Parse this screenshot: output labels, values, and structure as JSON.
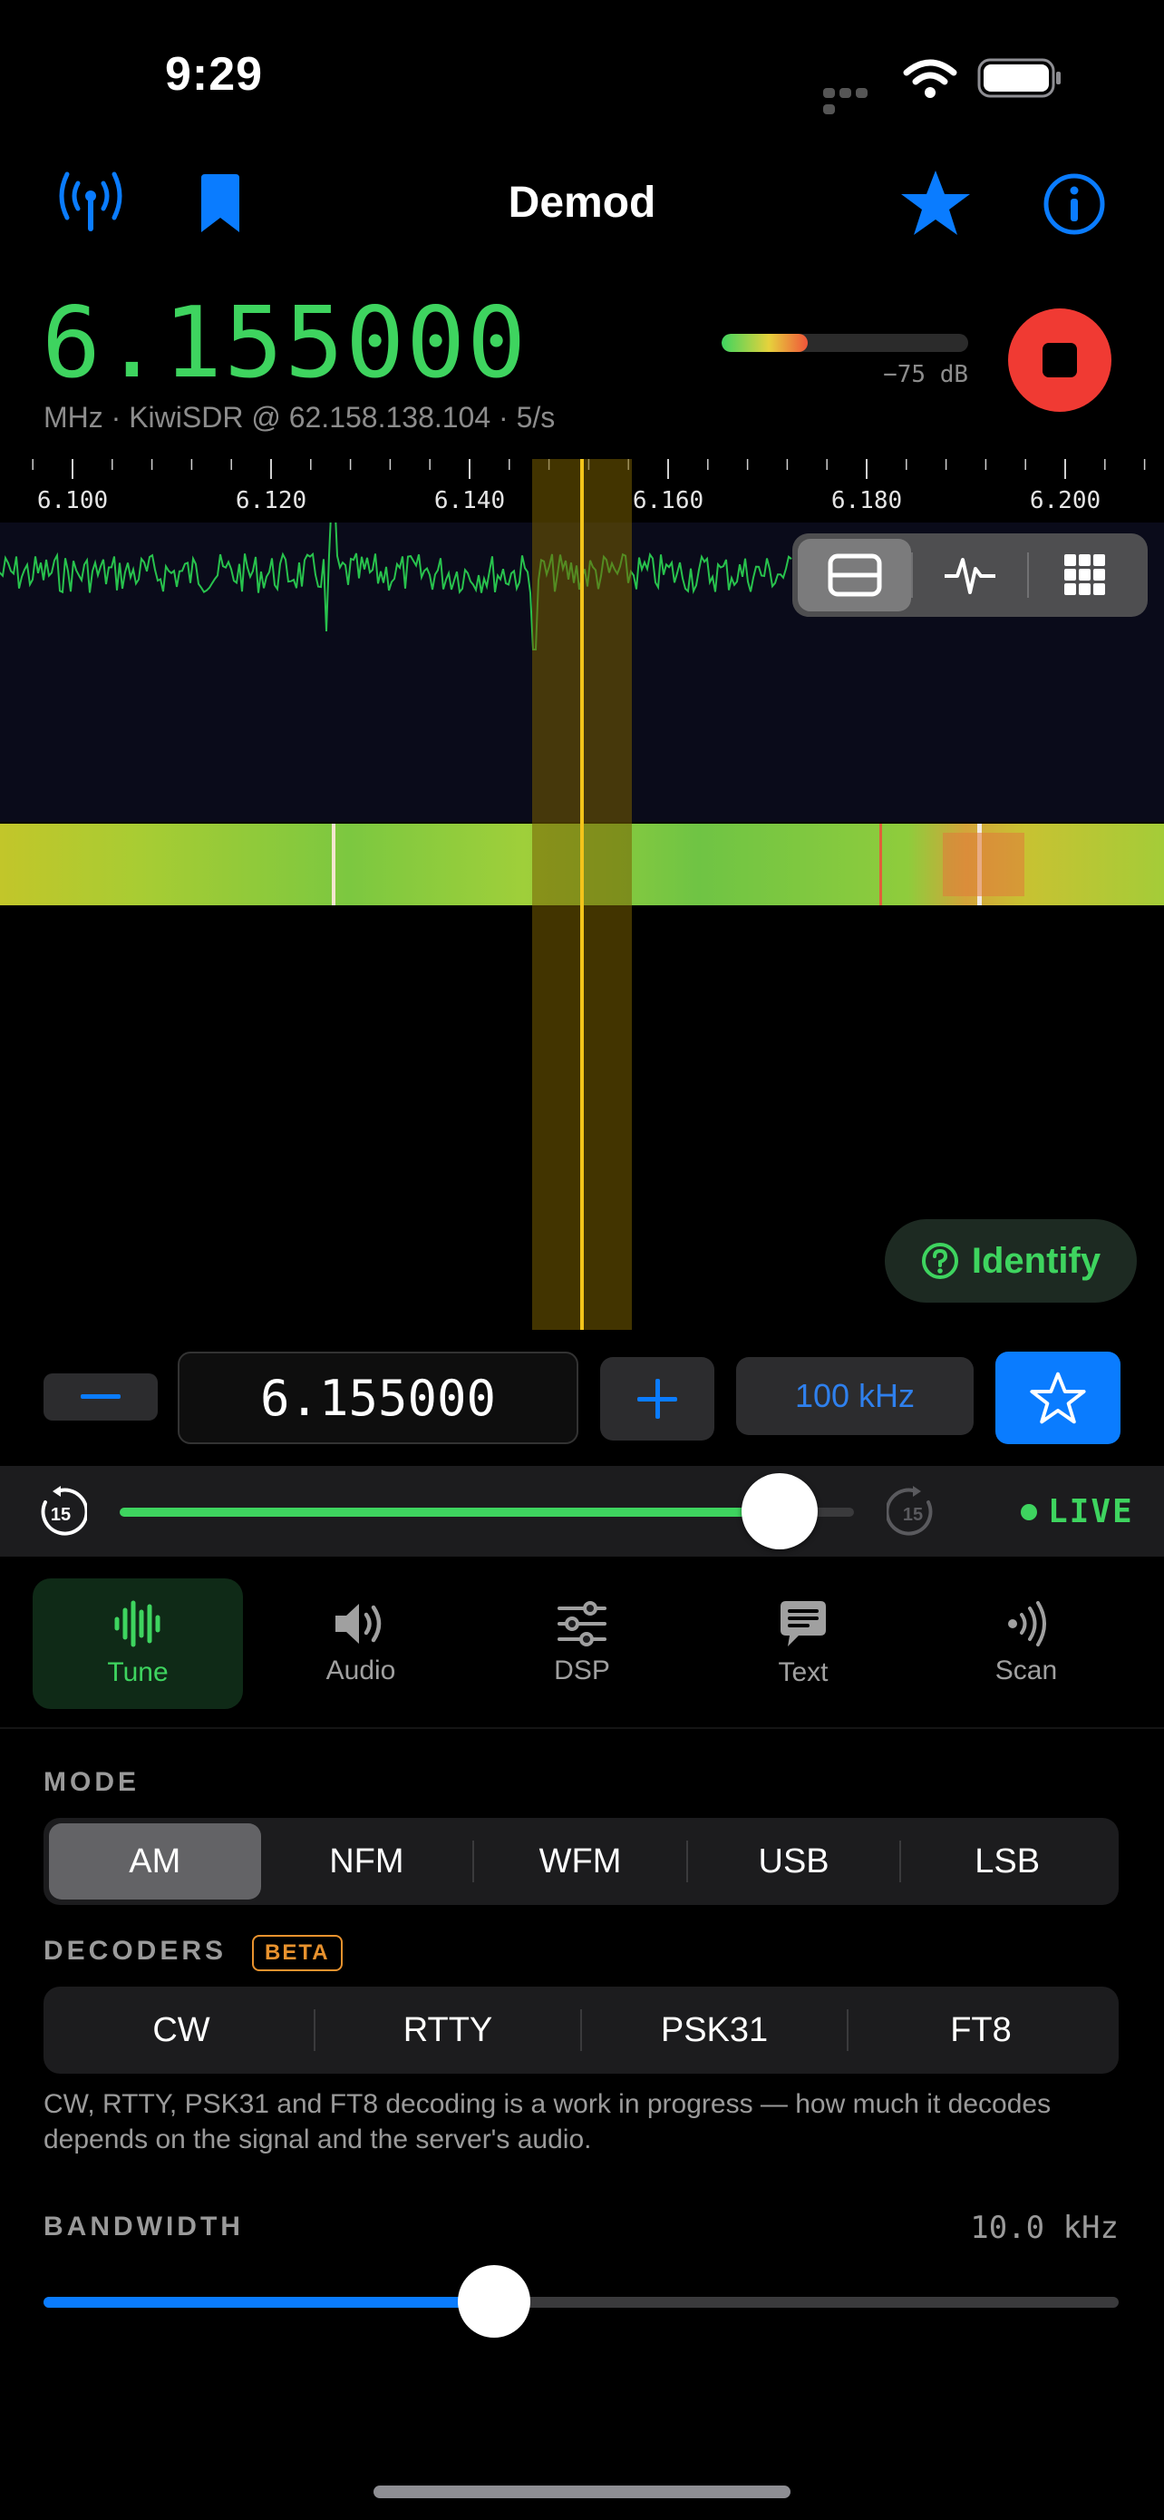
{
  "status": {
    "time": "9:29"
  },
  "header": {
    "title": "Demod"
  },
  "receiver": {
    "frequency": "6.155000",
    "subtitle": "MHz · KiwiSDR @ 62.158.138.104 · 5/s",
    "signal_level": 0.35,
    "signal_db": "−75 dB"
  },
  "spectrum": {
    "ticks": [
      "6.100",
      "6.120",
      "6.140",
      "6.160",
      "6.180",
      "6.200"
    ],
    "identify_label": "Identify"
  },
  "tuning": {
    "frequency_value": "6.155000",
    "step_label": "100 kHz"
  },
  "playback": {
    "progress": 0.9,
    "rewind_label": "15",
    "forward_label": "15",
    "live_label": "LIVE"
  },
  "tabs": [
    {
      "label": "Tune",
      "icon": "waveform-icon",
      "active": true
    },
    {
      "label": "Audio",
      "icon": "speaker-icon",
      "active": false
    },
    {
      "label": "DSP",
      "icon": "sliders-icon",
      "active": false
    },
    {
      "label": "Text",
      "icon": "message-icon",
      "active": false
    },
    {
      "label": "Scan",
      "icon": "scan-icon",
      "active": false
    }
  ],
  "mode": {
    "label": "MODE",
    "options": [
      "AM",
      "NFM",
      "WFM",
      "USB",
      "LSB"
    ],
    "selected": "AM"
  },
  "decoders": {
    "label": "DECODERS",
    "badge": "BETA",
    "options": [
      "CW",
      "RTTY",
      "PSK31",
      "FT8"
    ],
    "note": "CW, RTTY, PSK31 and FT8 decoding is a work in progress — how much it decodes depends on the signal and the server's audio."
  },
  "bandwidth": {
    "label": "BANDWIDTH",
    "value": "10.0 kHz",
    "level": 0.42
  },
  "colors": {
    "accent": "#0a7cff",
    "green": "#3ed45f",
    "record": "#f03a33"
  }
}
